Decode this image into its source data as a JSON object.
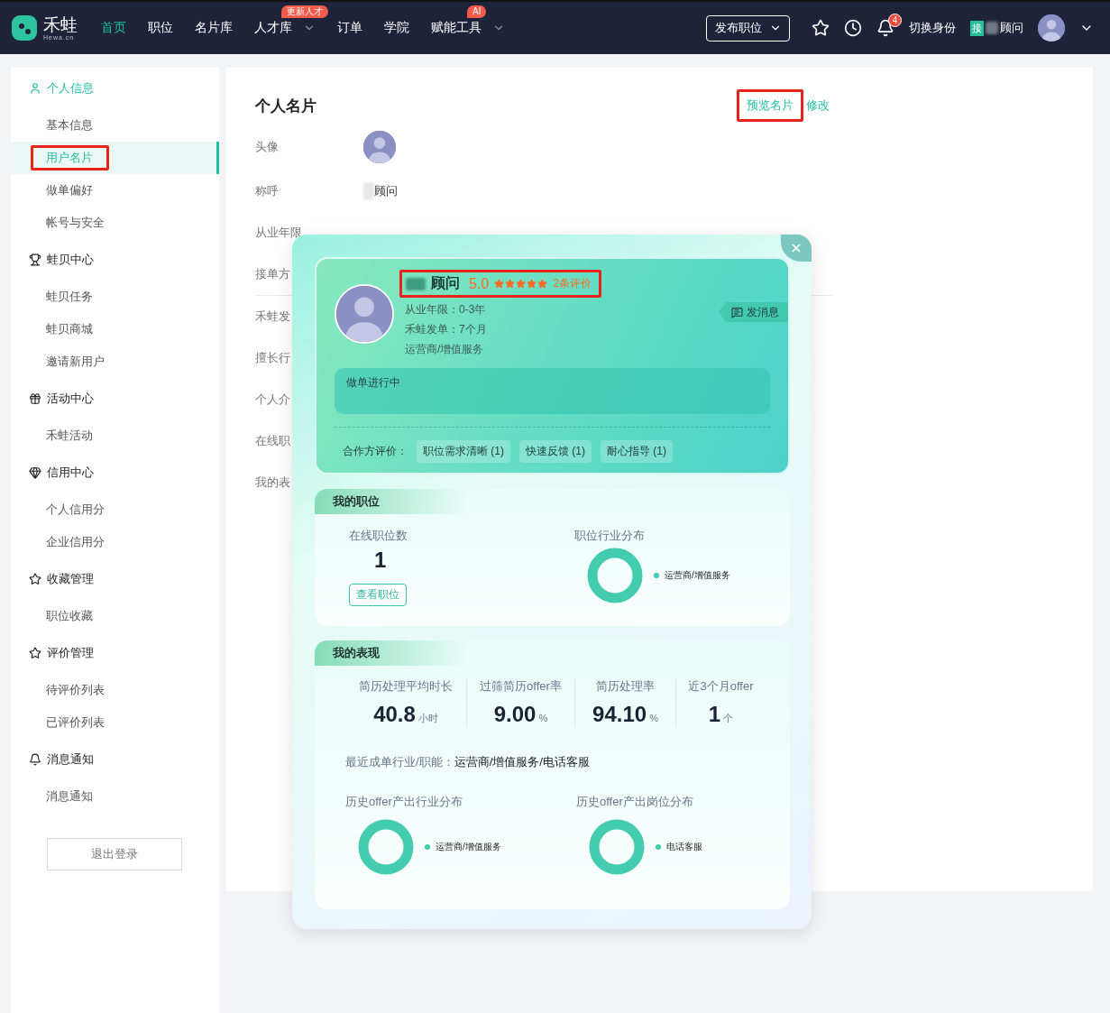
{
  "header": {
    "logo": {
      "name": "禾蛙",
      "domain": "Hewa.cn"
    },
    "nav": [
      {
        "label": "首页",
        "selected": true
      },
      {
        "label": "职位",
        "selected": false
      },
      {
        "label": "名片库",
        "selected": false
      },
      {
        "label": "人才库",
        "selected": false,
        "dropdown": true,
        "badge": "更新人才"
      },
      {
        "label": "订单",
        "selected": false
      },
      {
        "label": "学院",
        "selected": false
      },
      {
        "label": "赋能工具",
        "selected": false,
        "dropdown": true,
        "badge": "AI"
      }
    ],
    "post_button": "发布职位",
    "notification_count": "4",
    "switch_identity": "切换身份",
    "user": {
      "role_badge": "接",
      "name": "顾问",
      "redacted": true
    }
  },
  "sidebar": {
    "groups": [
      {
        "title": "个人信息",
        "selected": true,
        "items": [
          {
            "label": "基本信息",
            "selected": false,
            "annotated": false
          },
          {
            "label": "用户名片",
            "selected": true,
            "annotated": true
          },
          {
            "label": "做单偏好",
            "selected": false,
            "annotated": false
          },
          {
            "label": "帐号与安全",
            "selected": false,
            "annotated": false
          }
        ]
      },
      {
        "title": "蛙贝中心",
        "selected": false,
        "items": [
          {
            "label": "蛙贝任务",
            "selected": false,
            "annotated": false
          },
          {
            "label": "蛙贝商城",
            "selected": false,
            "annotated": false
          },
          {
            "label": "邀请新用户",
            "selected": false,
            "annotated": false
          }
        ]
      },
      {
        "title": "活动中心",
        "selected": false,
        "items": [
          {
            "label": "禾蛙活动",
            "selected": false,
            "annotated": false
          }
        ]
      },
      {
        "title": "信用中心",
        "selected": false,
        "items": [
          {
            "label": "个人信用分",
            "selected": false,
            "annotated": false
          },
          {
            "label": "企业信用分",
            "selected": false,
            "annotated": false
          }
        ]
      },
      {
        "title": "收藏管理",
        "selected": false,
        "items": [
          {
            "label": "职位收藏",
            "selected": false,
            "annotated": false
          }
        ]
      },
      {
        "title": "评价管理",
        "selected": false,
        "items": [
          {
            "label": "待评价列表",
            "selected": false,
            "annotated": false
          },
          {
            "label": "已评价列表",
            "selected": false,
            "annotated": false
          }
        ]
      },
      {
        "title": "消息通知",
        "selected": false,
        "items": [
          {
            "label": "消息通知",
            "selected": false,
            "annotated": false
          }
        ]
      }
    ],
    "logout": "退出登录"
  },
  "main": {
    "title": "个人名片",
    "actions": [
      {
        "label": "预览名片",
        "annotated": true
      },
      {
        "label": "修改",
        "annotated": false
      }
    ],
    "fields": [
      {
        "label": "头像",
        "kind": "avatar"
      },
      {
        "label": "称呼",
        "kind": "text",
        "value": "顾问",
        "redacted": true
      },
      {
        "label": "从业年限",
        "kind": "text"
      },
      {
        "label": "接单方",
        "kind": "text",
        "divider_after": true
      },
      {
        "label": "禾蛙发",
        "kind": "text"
      },
      {
        "label": "擅长行",
        "kind": "text"
      },
      {
        "label": "个人介",
        "kind": "text"
      },
      {
        "label": "在线职",
        "kind": "text"
      },
      {
        "label": "我的表",
        "kind": "text"
      }
    ]
  },
  "modal": {
    "card": {
      "name": "顾问",
      "redacted": true,
      "annotated": true,
      "rating": "5.0",
      "stars": 5,
      "reviews": "2条评价",
      "details": [
        "从业年限：0-3年",
        "禾蛙发单：7个月",
        "运营商/增值服务"
      ],
      "message_button": "发消息",
      "status": "做单进行中",
      "review_label": "合作方评价：",
      "review_tags": [
        "职位需求清晰 (1)",
        "快速反馈 (1)",
        "耐心指导 (1)"
      ]
    },
    "jobs": {
      "title": "我的职位",
      "online_label": "在线职位数",
      "online_count": "1",
      "view_button": "查看职位",
      "distribution": {
        "title": "职位行业分布",
        "legend": [
          "运营商/增值服务"
        ]
      }
    },
    "performance": {
      "title": "我的表现",
      "stats": [
        {
          "label": "简历处理平均时长",
          "value": "40.8",
          "unit": "小时"
        },
        {
          "label": "过筛简历offer率",
          "value": "9.00",
          "unit": "%"
        },
        {
          "label": "简历处理率",
          "value": "94.10",
          "unit": "%"
        },
        {
          "label": "近3个月offer",
          "value": "1",
          "unit": "个"
        }
      ],
      "recent_label": "最近成单行业/职能：",
      "recent_value": "运营商/增值服务/电话客服",
      "distributions": [
        {
          "title": "历史offer产出行业分布",
          "legend": [
            "运营商/增值服务"
          ]
        },
        {
          "title": "历史offer产出岗位分布",
          "legend": [
            "电话客服"
          ]
        }
      ]
    }
  }
}
